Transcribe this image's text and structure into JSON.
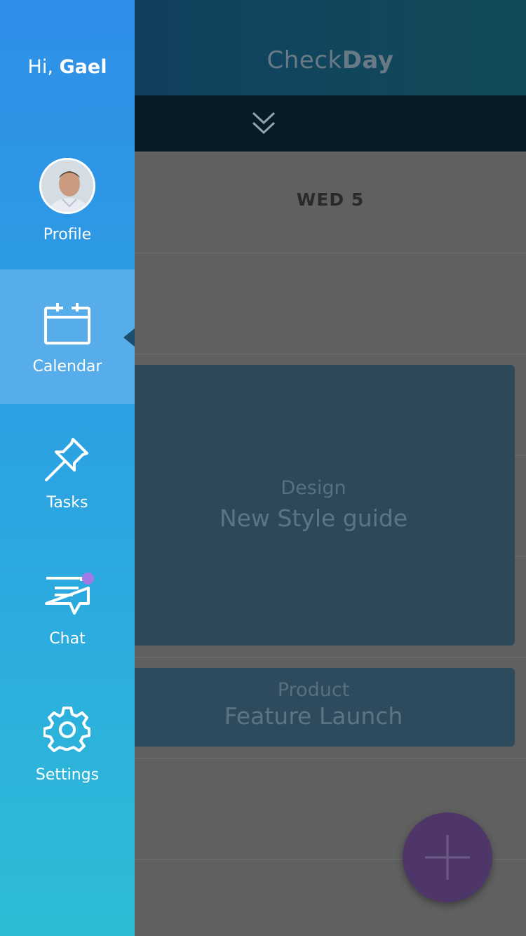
{
  "header": {
    "brand_light": "Check",
    "brand_bold": "Day"
  },
  "calendar": {
    "day_label": "WED 5"
  },
  "events": [
    {
      "category": "Design",
      "title": "New Style guide"
    },
    {
      "category": "Product",
      "title": "Feature Launch"
    }
  ],
  "drawer": {
    "greeting_prefix": "Hi,",
    "user_name": "Gael",
    "items": [
      {
        "label": "Profile",
        "icon": "avatar"
      },
      {
        "label": "Calendar",
        "icon": "calendar-icon",
        "active": true
      },
      {
        "label": "Tasks",
        "icon": "pushpin-icon"
      },
      {
        "label": "Chat",
        "icon": "chat-bubble-icon",
        "has_notification": true
      },
      {
        "label": "Settings",
        "icon": "gear-icon"
      }
    ]
  },
  "colors": {
    "drawer_top": "#2e8fe8",
    "drawer_bottom": "#2cbdd6",
    "active_item": "#56ade9",
    "notification_dot": "#a379e6",
    "fab": "#4e3768"
  }
}
